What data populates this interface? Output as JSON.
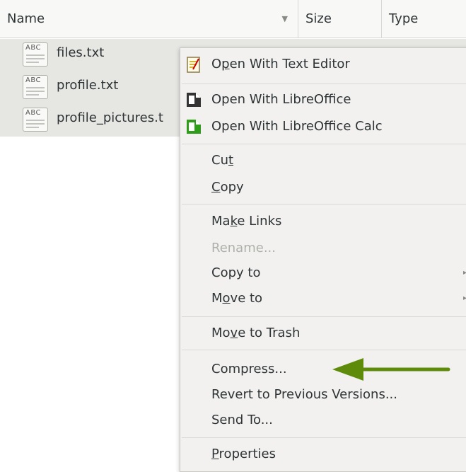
{
  "columns": {
    "name": "Name",
    "size": "Size",
    "type": "Type"
  },
  "files": [
    {
      "name": "files.txt",
      "icon": "text-file-icon",
      "selected": true
    },
    {
      "name": "profile.txt",
      "icon": "text-file-icon",
      "selected": true
    },
    {
      "name": "profile_pictures.t",
      "icon": "text-file-icon",
      "selected": true
    }
  ],
  "file_icon_text": "ABC",
  "menu": {
    "open_text_editor_pre": "O",
    "open_text_editor_u": "p",
    "open_text_editor_post": "en With Text Editor",
    "open_libreoffice": "Open With LibreOffice",
    "open_libreoffice_calc": "Open With LibreOffice Calc",
    "cut_pre": "Cu",
    "cut_u": "t",
    "copy_u": "C",
    "copy_post": "opy",
    "make_links_pre": "Ma",
    "make_links_u": "k",
    "make_links_post": "e Links",
    "rename": "Rename...",
    "copy_to": "Copy to",
    "move_to_pre": "M",
    "move_to_u": "o",
    "move_to_post": "ve to",
    "move_to_trash_pre": "Mo",
    "move_to_trash_u": "v",
    "move_to_trash_post": "e to Trash",
    "compress": "Compress...",
    "revert": "Revert to Previous Versions...",
    "send_to": "Send To...",
    "properties_u": "P",
    "properties_post": "roperties"
  },
  "colors": {
    "arrow": "#5e8c0a",
    "selection": "#e6e6e3",
    "menu_bg": "#f2f1ef",
    "disabled": "#aeb0ab"
  }
}
